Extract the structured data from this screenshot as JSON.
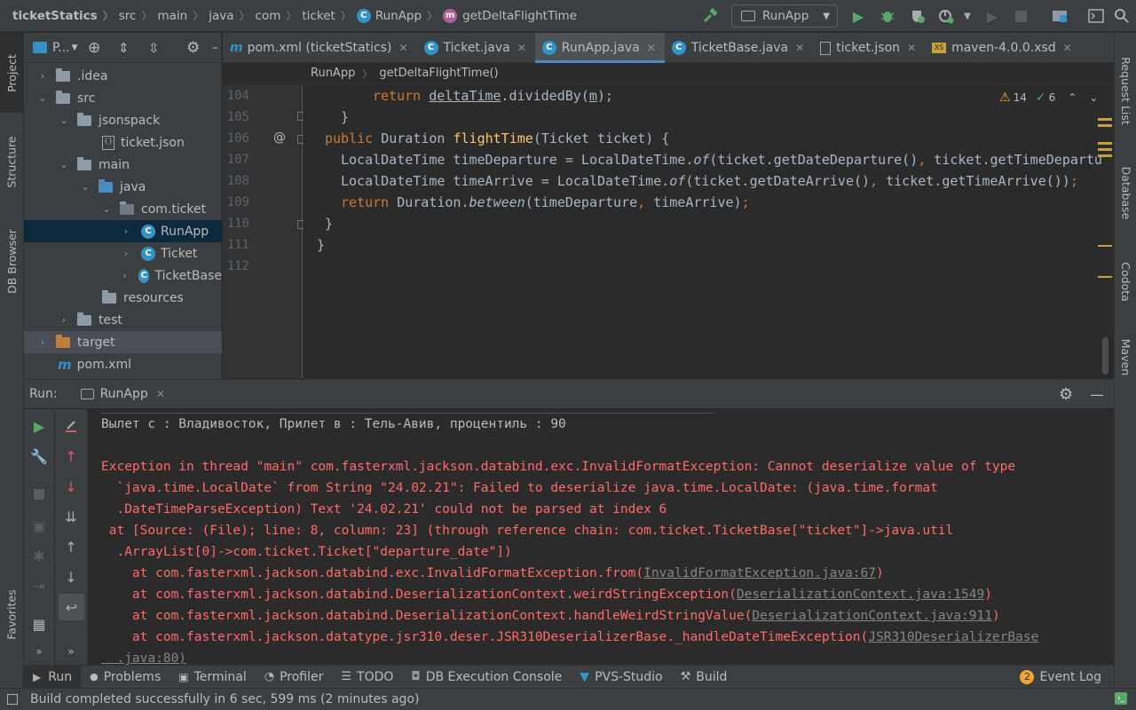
{
  "navbar": {
    "crumbs": [
      "ticketStatics",
      "src",
      "main",
      "java",
      "com",
      "ticket",
      "RunApp",
      "getDeltaFlightTime"
    ],
    "run_config": "RunApp"
  },
  "left_strip": {
    "project": "Project",
    "structure": "Structure",
    "db_browser": "DB Browser",
    "favorites": "Favorites"
  },
  "right_strip": {
    "request_list": "Request List",
    "database": "Database",
    "codota": "Codota",
    "maven": "Maven"
  },
  "project": {
    "header": "P...",
    "items": [
      {
        "label": ".idea",
        "icon": "folder-icon"
      },
      {
        "label": "src",
        "icon": "folder-icon"
      },
      {
        "label": "jsonspack",
        "icon": "folder-icon"
      },
      {
        "label": "ticket.json",
        "icon": "json-file-icon"
      },
      {
        "label": "main",
        "icon": "folder-icon"
      },
      {
        "label": "java",
        "icon": "folder-icon"
      },
      {
        "label": "com.ticket",
        "icon": "package-icon"
      },
      {
        "label": "RunApp",
        "icon": "class-icon"
      },
      {
        "label": "Ticket",
        "icon": "class-icon"
      },
      {
        "label": "TicketBase",
        "icon": "class-icon"
      },
      {
        "label": "resources",
        "icon": "folder-icon"
      },
      {
        "label": "test",
        "icon": "folder-icon"
      },
      {
        "label": "target",
        "icon": "folder-icon"
      },
      {
        "label": "pom.xml",
        "icon": "maven-icon"
      }
    ]
  },
  "tabs": [
    {
      "label": "pom.xml (ticketStatics)",
      "icon": "m"
    },
    {
      "label": "Ticket.java",
      "icon": "c"
    },
    {
      "label": "RunApp.java",
      "icon": "c"
    },
    {
      "label": "TicketBase.java",
      "icon": "c"
    },
    {
      "label": "ticket.json",
      "icon": "json"
    },
    {
      "label": "maven-4.0.0.xsd",
      "icon": "xs"
    }
  ],
  "editor_crumbs": {
    "cls": "RunApp",
    "method": "getDeltaFlightTime()"
  },
  "inspections": {
    "warnings": "14",
    "ok": "6"
  },
  "line_numbers": [
    "104",
    "105",
    "106",
    "107",
    "108",
    "109",
    "110",
    "111",
    "112"
  ],
  "code": {
    "l104_kw": "return ",
    "l104_var": "deltaTime",
    "l104_mid": ".dividedBy(",
    "l104_arg": "m",
    "l104_end": ");",
    "l105": "}",
    "l106_kw": "public ",
    "l106_type": "Duration ",
    "l106_fn": "flightTime",
    "l106_rest": "(Ticket ticket) {",
    "l107_a": "LocalDateTime timeDeparture = LocalDateTime.",
    "l107_of": "of",
    "l107_b": "(ticket.getDateDeparture()",
    "l107_c": ", ",
    "l107_d": "ticket.getTimeDeparture",
    "l108_a": "LocalDateTime timeArrive = LocalDateTime.",
    "l108_of": "of",
    "l108_b": "(ticket.getDateArrive()",
    "l108_c": ", ",
    "l108_d": "ticket.getTimeArrive())",
    "l108_e": ";",
    "l109_kw": "return ",
    "l109_a": "Duration.",
    "l109_fn": "between",
    "l109_b": "(timeDeparture",
    "l109_c": ", ",
    "l109_d": "timeArrive)",
    "l109_e": ";",
    "l110": "}",
    "l111": "}"
  },
  "run_panel": {
    "title": "Run:",
    "tab": "RunApp",
    "lines": [
      {
        "text": "Вылет с : Владивосток, Прилет в : Тель-Авив, процентиль : 90",
        "style": "norm"
      },
      {
        "text": "Exception in thread \"main\" com.fasterxml.jackson.databind.exc.InvalidFormatException: Cannot deserialize value of type",
        "style": "err"
      },
      {
        "text": "  `java.time.LocalDate` from String \"24.02.21\": Failed to deserialize java.time.LocalDate: (java.time.format",
        "style": "err"
      },
      {
        "text": "  .DateTimeParseException) Text '24.02.21' could not be parsed at index 6",
        "style": "err"
      },
      {
        "text": " at [Source: (File); line: 8, column: 23] (through reference chain: com.ticket.TicketBase[\"ticket\"]->java.util",
        "style": "err"
      },
      {
        "text": "  .ArrayList[0]->com.ticket.Ticket[\"departure_date\"])",
        "style": "err"
      }
    ],
    "stack": [
      {
        "prefix": "    at com.fasterxml.jackson.databind.exc.InvalidFormatException.from(",
        "link": "InvalidFormatException.java:67",
        "suffix": ")"
      },
      {
        "prefix": "    at com.fasterxml.jackson.databind.DeserializationContext.weirdStringException(",
        "link": "DeserializationContext.java:1549",
        "suffix": ")"
      },
      {
        "prefix": "    at com.fasterxml.jackson.databind.DeserializationContext.handleWeirdStringValue(",
        "link": "DeserializationContext.java:911",
        "suffix": ")"
      },
      {
        "prefix": "    at com.fasterxml.jackson.datatype.jsr310.deser.JSR310DeserializerBase._handleDateTimeException(",
        "link": "JSR310DeserializerBase",
        "suffix": ""
      }
    ],
    "last_line": "  .java:80)"
  },
  "bottom_tools": [
    "Run",
    "Problems",
    "Terminal",
    "Profiler",
    "TODO",
    "DB Execution Console",
    "PVS-Studio",
    "Build"
  ],
  "event_log": {
    "count": "2",
    "label": "Event Log"
  },
  "status": "Build completed successfully in 6 sec, 599 ms (2 minutes ago)",
  "colors": {
    "accent": "#4a88c7",
    "run_green": "#59a869",
    "error": "#ff6b68",
    "warning": "#f0a732"
  }
}
